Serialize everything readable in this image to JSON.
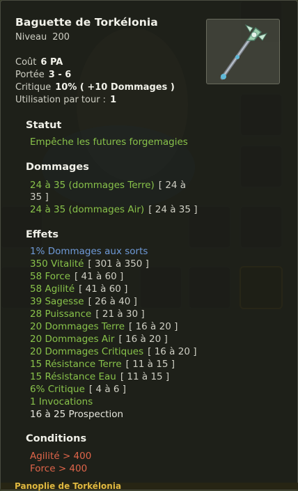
{
  "item": {
    "name": "Baguette de Torkélonia",
    "level_label": "Niveau",
    "level": "200",
    "icon": "wand-icon"
  },
  "stats": [
    {
      "label": "Coût",
      "value": "6 PA"
    },
    {
      "label": "Portée",
      "value": "3 - 6"
    },
    {
      "label": "Critique",
      "value": "10% ( +10 Dommages )"
    },
    {
      "label": "Utilisation par tour :",
      "value": "1"
    }
  ],
  "statut": {
    "heading": "Statut",
    "text": "Empêche les futures forgemagies"
  },
  "dommages": {
    "heading": "Dommages",
    "lines": [
      {
        "text": "24 à 35 (dommages Terre)",
        "range": "[ 24 à",
        "range2": "35 ]"
      },
      {
        "text": "24 à 35 (dommages Air)",
        "range": "[ 24 à 35 ]"
      }
    ]
  },
  "effets": {
    "heading": "Effets",
    "lines": [
      {
        "text": "1% Dommages aux sorts",
        "range": "",
        "color": "blue"
      },
      {
        "text": "350 Vitalité",
        "range": "[ 301 à 350 ]",
        "color": "green"
      },
      {
        "text": "58 Force",
        "range": "[ 41 à 60 ]",
        "color": "green"
      },
      {
        "text": "58 Agilité",
        "range": "[ 41 à 60 ]",
        "color": "green"
      },
      {
        "text": "39 Sagesse",
        "range": "[ 26 à 40 ]",
        "color": "green"
      },
      {
        "text": "28 Puissance",
        "range": "[ 21 à 30 ]",
        "color": "green"
      },
      {
        "text": "20 Dommages Terre",
        "range": "[ 16 à 20 ]",
        "color": "green"
      },
      {
        "text": "20 Dommages Air",
        "range": "[ 16 à 20 ]",
        "color": "green"
      },
      {
        "text": "20 Dommages Critiques",
        "range": "[ 16 à 20 ]",
        "color": "green"
      },
      {
        "text": "15 Résistance Terre",
        "range": "[ 11 à 15 ]",
        "color": "green"
      },
      {
        "text": "15 Résistance Eau",
        "range": "[ 11 à 15 ]",
        "color": "green"
      },
      {
        "text": "6% Critique",
        "range": "[ 4 à 6 ]",
        "color": "green"
      },
      {
        "text": "1 Invocations",
        "range": "",
        "color": "green"
      },
      {
        "text": "16 à 25 Prospection",
        "range": "",
        "color": "white"
      }
    ]
  },
  "conditions": {
    "heading": "Conditions",
    "lines": [
      "Agilité > 400",
      "Force > 400"
    ]
  },
  "footer": {
    "text": "Panoplie de Torkélonia"
  },
  "colors": {
    "green": "#88c24a",
    "blue": "#6f9ad8",
    "red": "#e0654a",
    "footer": "#e0b840"
  }
}
